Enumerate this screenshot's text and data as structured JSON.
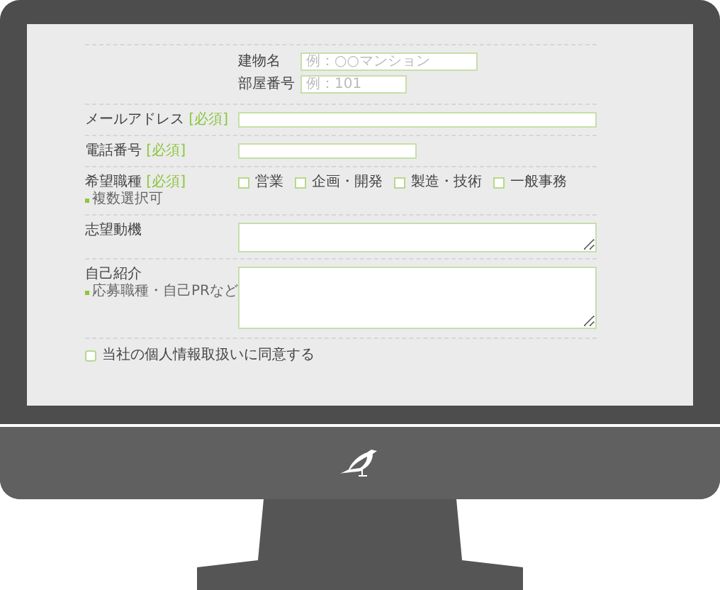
{
  "address_fields": [
    {
      "label": "建物名",
      "placeholder": "例：○○マンション"
    },
    {
      "label": "部屋番号",
      "placeholder": "例：101"
    }
  ],
  "rows": [
    {
      "kind": "text",
      "label": "メールアドレス",
      "tag": "[必須]"
    },
    {
      "kind": "text",
      "label": "電話番号",
      "tag": "[必須]"
    },
    {
      "kind": "checkboxes",
      "label": "希望職種",
      "tag": "[必須]",
      "note": "複数選択可",
      "options": [
        {
          "label": "営業",
          "checked": false
        },
        {
          "label": "企画・開発",
          "checked": false
        },
        {
          "label": "製造・技術",
          "checked": false
        },
        {
          "label": "一般事務",
          "checked": false
        }
      ]
    },
    {
      "kind": "textarea",
      "label": "志望動機"
    },
    {
      "kind": "textarea",
      "label": "自己紹介",
      "note": "応募職種・自己PRなど"
    }
  ],
  "agreement": {
    "label": "当社の個人情報取扱いに同意する",
    "checked": false
  }
}
